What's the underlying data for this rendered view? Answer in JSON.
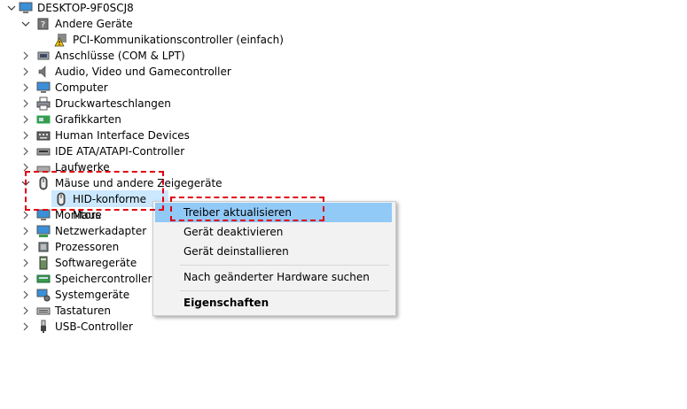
{
  "root": {
    "label": "DESKTOP-9F0SCJ8",
    "icon": "computer-icon",
    "expanded": true
  },
  "nodes": [
    {
      "label": "Andere Geräte",
      "icon": "unknown-device-icon",
      "expanded": true
    },
    {
      "label": "PCI-Kommunikationscontroller (einfach)",
      "icon": "warning-device-icon",
      "child": true
    },
    {
      "label": "Anschlüsse (COM & LPT)",
      "icon": "port-icon"
    },
    {
      "label": "Audio, Video und Gamecontroller",
      "icon": "speaker-icon"
    },
    {
      "label": "Computer",
      "icon": "monitor-icon"
    },
    {
      "label": "Druckwarteschlangen",
      "icon": "printer-icon"
    },
    {
      "label": "Grafikkarten",
      "icon": "display-adapter-icon"
    },
    {
      "label": "Human Interface Devices",
      "icon": "hid-icon"
    },
    {
      "label": "IDE ATA/ATAPI-Controller",
      "icon": "ide-controller-icon"
    },
    {
      "label": "Laufwerke",
      "icon": "disk-drive-icon"
    },
    {
      "label": "Mäuse und andere Zeigegeräte",
      "icon": "mouse-icon",
      "expanded": true
    },
    {
      "label": "HID-konforme Maus",
      "icon": "mouse-icon",
      "child": true,
      "selected": true
    },
    {
      "label": "Monitore",
      "icon": "monitor-icon"
    },
    {
      "label": "Netzwerkadapter",
      "icon": "network-adapter-icon"
    },
    {
      "label": "Prozessoren",
      "icon": "processor-icon"
    },
    {
      "label": "Softwaregeräte",
      "icon": "software-device-icon"
    },
    {
      "label": "Speichercontroller",
      "icon": "storage-controller-icon"
    },
    {
      "label": "Systemgeräte",
      "icon": "system-device-icon"
    },
    {
      "label": "Tastaturen",
      "icon": "keyboard-icon"
    },
    {
      "label": "USB-Controller",
      "icon": "usb-icon"
    }
  ],
  "context_menu": {
    "items": [
      {
        "label": "Treiber aktualisieren",
        "highlighted": true
      },
      {
        "label": "Gerät deaktivieren"
      },
      {
        "label": "Gerät deinstallieren"
      },
      {
        "label": "Nach geänderter Hardware suchen"
      },
      {
        "label": "Eigenschaften",
        "bold": true
      }
    ]
  },
  "colors": {
    "selection": "#cce8ff",
    "menu_highlight": "#91c9f7",
    "annotation": "#e00010"
  }
}
